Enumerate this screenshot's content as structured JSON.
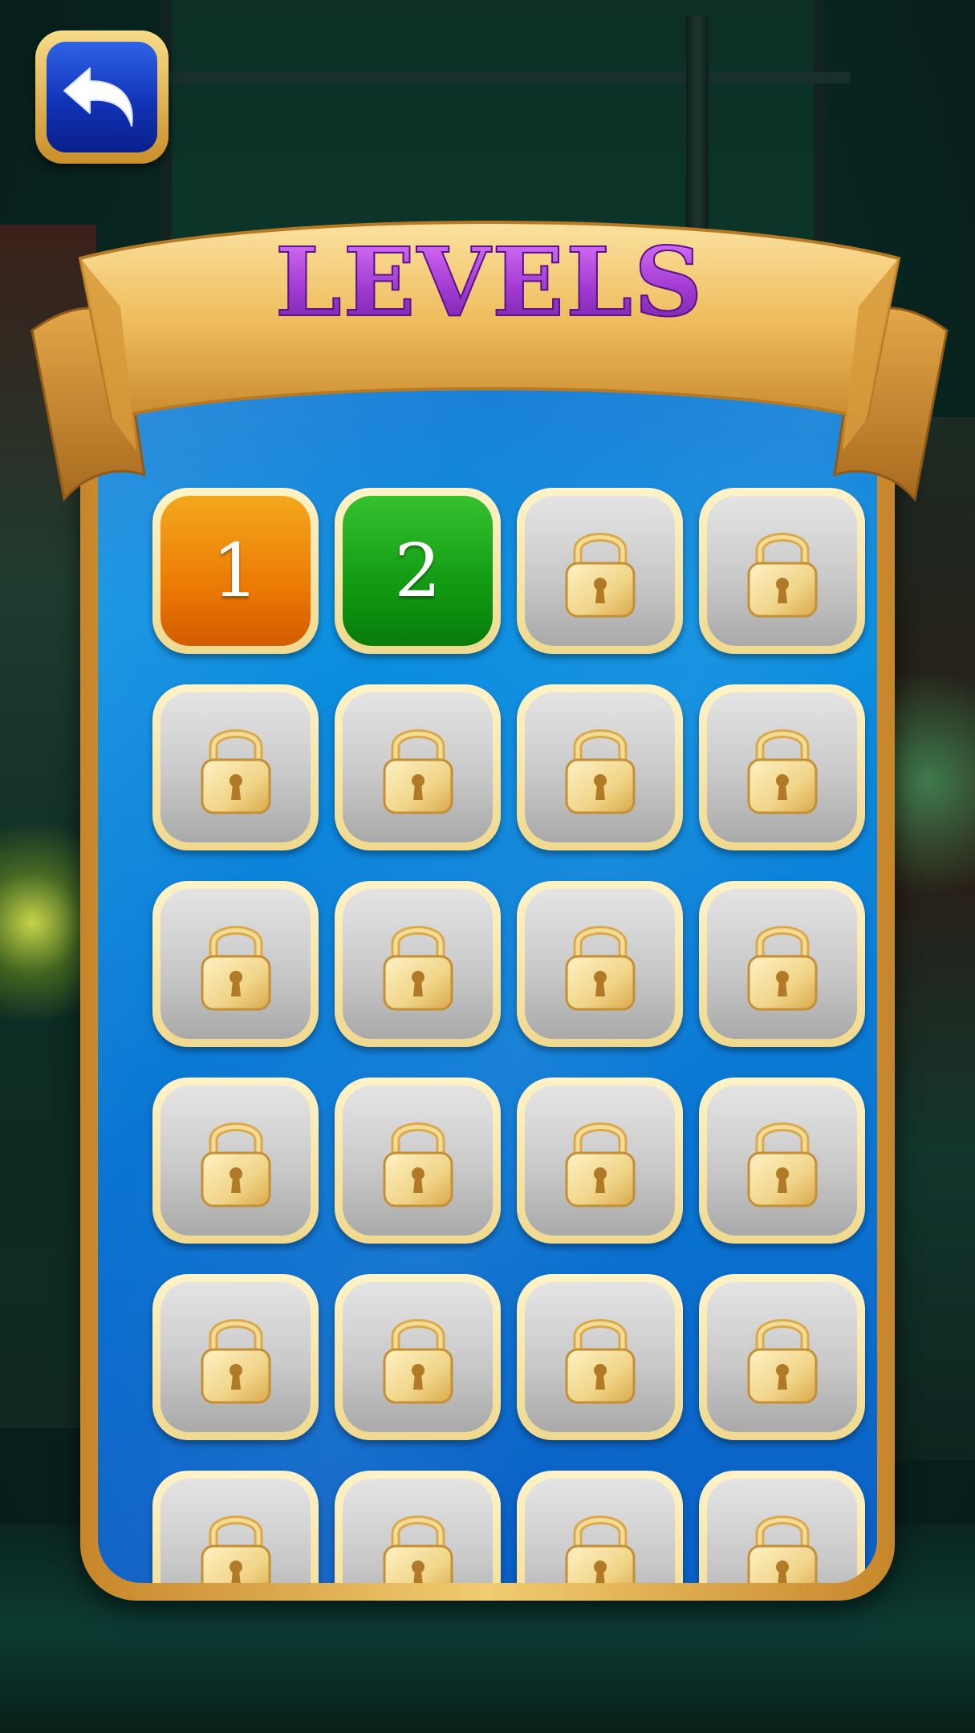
{
  "header": {
    "title": "LEVELS",
    "back_icon": "undo-arrow-icon"
  },
  "colors": {
    "unlocked_current": "#ec7a05",
    "unlocked_next": "#119a12",
    "locked": "#c9c9c9",
    "frame_gold": "#f1cc70",
    "board_blue": "#0b8fe0",
    "title_purple": "#a23bd2"
  },
  "levels": [
    {
      "label": "1",
      "state": "current"
    },
    {
      "label": "2",
      "state": "unlocked"
    },
    {
      "label": "",
      "state": "locked"
    },
    {
      "label": "",
      "state": "locked"
    },
    {
      "label": "",
      "state": "locked"
    },
    {
      "label": "",
      "state": "locked"
    },
    {
      "label": "",
      "state": "locked"
    },
    {
      "label": "",
      "state": "locked"
    },
    {
      "label": "",
      "state": "locked"
    },
    {
      "label": "",
      "state": "locked"
    },
    {
      "label": "",
      "state": "locked"
    },
    {
      "label": "",
      "state": "locked"
    },
    {
      "label": "",
      "state": "locked"
    },
    {
      "label": "",
      "state": "locked"
    },
    {
      "label": "",
      "state": "locked"
    },
    {
      "label": "",
      "state": "locked"
    },
    {
      "label": "",
      "state": "locked"
    },
    {
      "label": "",
      "state": "locked"
    },
    {
      "label": "",
      "state": "locked"
    },
    {
      "label": "",
      "state": "locked"
    },
    {
      "label": "",
      "state": "locked"
    },
    {
      "label": "",
      "state": "locked"
    },
    {
      "label": "",
      "state": "locked"
    },
    {
      "label": "",
      "state": "locked"
    }
  ],
  "lock_icon": "padlock-icon"
}
